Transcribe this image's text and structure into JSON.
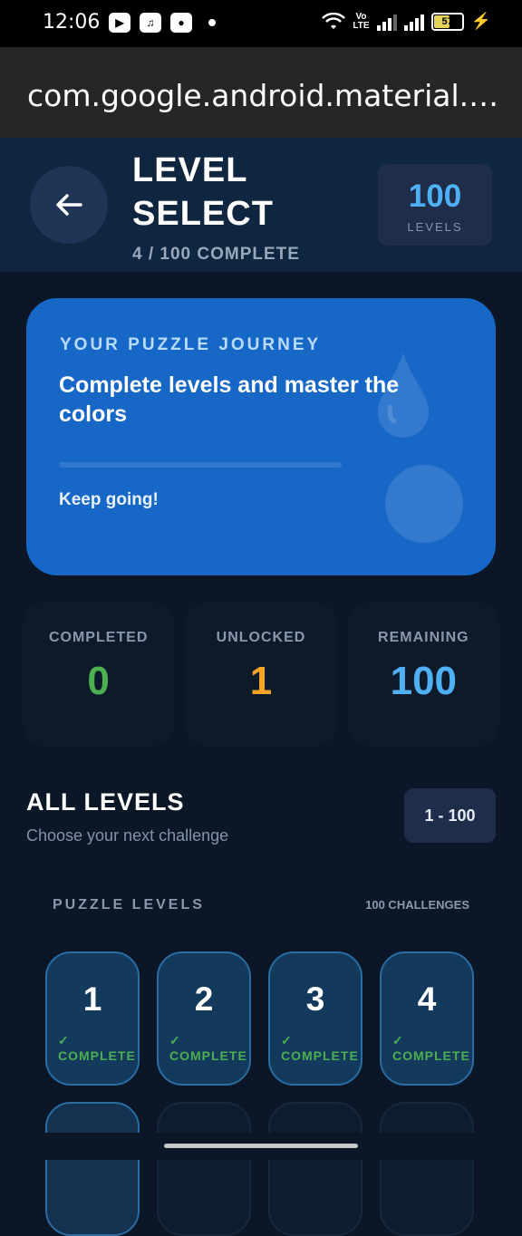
{
  "status_bar": {
    "time": "12:06",
    "volte": "Vo\nLTE",
    "battery": "57"
  },
  "browser": {
    "url": "com.google.android.material.…"
  },
  "header": {
    "title": "LEVEL SELECT",
    "subtitle": "4 / 100 COMPLETE",
    "levels_count": "100",
    "levels_label": "LEVELS"
  },
  "journey": {
    "kicker": "YOUR PUZZLE JOURNEY",
    "headline": "Complete levels and master the colors",
    "message": "Keep going!",
    "progress": 0.0
  },
  "stats": [
    {
      "label": "COMPLETED",
      "value": "0",
      "color": "#4caf50"
    },
    {
      "label": "UNLOCKED",
      "value": "1",
      "color": "#f7a325"
    },
    {
      "label": "REMAINING",
      "value": "100",
      "color": "#4fb0f5"
    }
  ],
  "levels_section": {
    "title": "ALL LEVELS",
    "subtitle": "Choose your next challenge",
    "range": "1 - 100",
    "group_label": "PUZZLE LEVELS",
    "group_count": "100 CHALLENGES"
  },
  "levels": [
    {
      "number": "1",
      "status": "✓ COMPLETE"
    },
    {
      "number": "2",
      "status": "✓ COMPLETE"
    },
    {
      "number": "3",
      "status": "✓ COMPLETE"
    },
    {
      "number": "4",
      "status": "✓ COMPLETE"
    }
  ],
  "colors": {
    "background": "#0b1726",
    "header": "#0f2640",
    "accent_card": "#1767c6",
    "accent_blue": "#4fb0f5",
    "complete_green": "#4caf50"
  }
}
